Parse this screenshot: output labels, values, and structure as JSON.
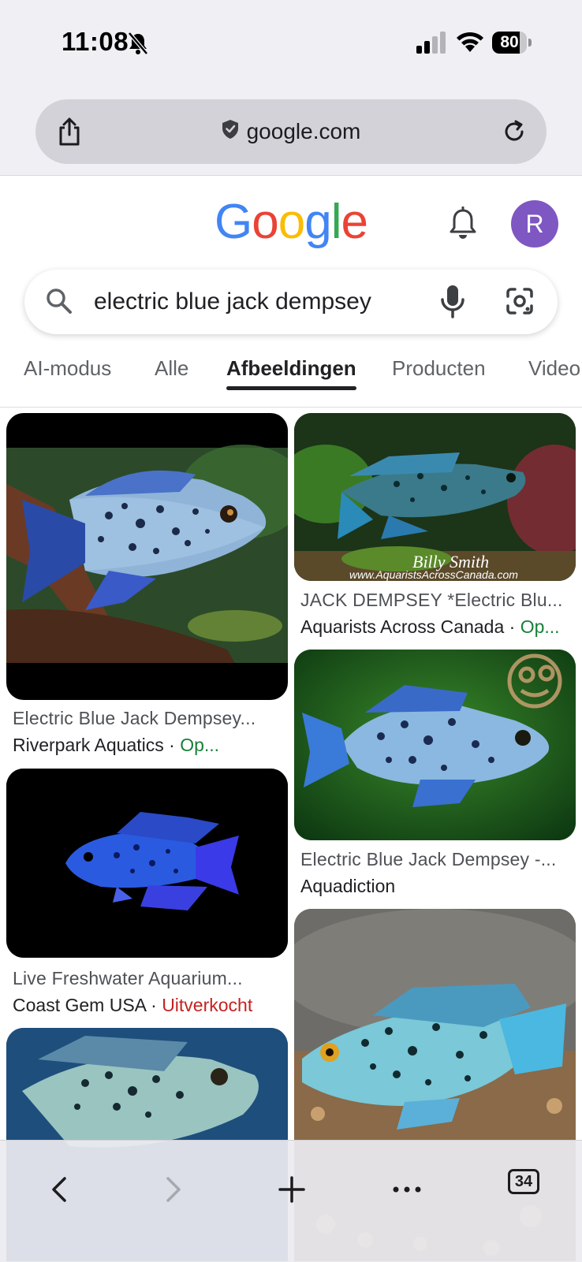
{
  "status_bar": {
    "time": "11:08",
    "battery_level": "80",
    "battery_fraction": 0.8
  },
  "browser": {
    "url": "google.com",
    "tab_count": "34"
  },
  "google": {
    "logo_letters": [
      "G",
      "o",
      "o",
      "g",
      "l",
      "e"
    ],
    "logo_colors": [
      "#4285f4",
      "#ea4335",
      "#fbbc05",
      "#4285f4",
      "#34a853",
      "#ea4335"
    ],
    "avatar_letter": "R",
    "avatar_color": "#7e57c2"
  },
  "search": {
    "query": "electric blue jack dempsey"
  },
  "tabs": [
    {
      "label": "AI-modus"
    },
    {
      "label": "Alle"
    },
    {
      "label": "Afbeeldingen",
      "active": true
    },
    {
      "label": "Producten"
    },
    {
      "label": "Video"
    }
  ],
  "results": [
    {
      "title": "Electric Blue Jack Dempsey...",
      "source": "Riverpark Aquatics",
      "status": "Op...",
      "status_color": "#188038"
    },
    {
      "title": "Live Freshwater Aquarium...",
      "source": "Coast Gem USA",
      "status": "Uitverkocht",
      "status_color": "#c5221f"
    },
    {
      "title": "",
      "source": "",
      "status": ""
    },
    {
      "title": "JACK DEMPSEY *Electric Blu...",
      "source": "Aquarists Across Canada",
      "status": "Op...",
      "status_color": "#188038",
      "watermark": "Billy Smith www.AquaristsAcrossCanada.com"
    },
    {
      "title": "Electric Blue Jack Dempsey -...",
      "source": "Aquadiction",
      "status": ""
    },
    {
      "title": "",
      "source": "",
      "status": ""
    }
  ],
  "separator": "·",
  "icons": [
    "bell-off-icon",
    "signal-icon",
    "wifi-icon",
    "battery-icon",
    "share-icon",
    "shield-icon",
    "reload-icon",
    "notification-bell-icon",
    "search-icon",
    "microphone-icon",
    "google-lens-icon",
    "back-icon",
    "forward-icon",
    "new-tab-icon",
    "more-icon",
    "tabs-icon"
  ]
}
